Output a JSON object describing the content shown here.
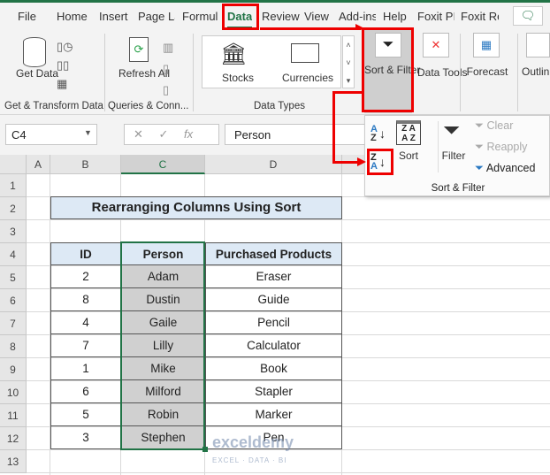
{
  "tabs": [
    "File",
    "Home",
    "Insert",
    "Page La",
    "Formul",
    "Data",
    "Review",
    "View",
    "Add-ins",
    "Help",
    "Foxit PI",
    "Foxit Re"
  ],
  "ribbon": {
    "get_data": "Get Data",
    "group_get": "Get & Transform Data",
    "refresh": "Refresh All",
    "group_queries": "Queries & Conn...",
    "stocks": "Stocks",
    "currencies": "Currencies",
    "group_types": "Data Types",
    "sort_filter": "Sort & Filter",
    "data_tools": "Data Tools",
    "forecast": "Forecast",
    "outline": "Outlin"
  },
  "sort_panel": {
    "sort": "Sort",
    "filter": "Filter",
    "clear": "Clear",
    "reapply": "Reapply",
    "advanced": "Advanced",
    "group": "Sort & Filter"
  },
  "formula_bar": {
    "name_box": "C4",
    "fx": "fx",
    "value": "Person"
  },
  "columns": [
    "A",
    "B",
    "C",
    "D"
  ],
  "rows": [
    "1",
    "2",
    "3",
    "4",
    "5",
    "6",
    "7",
    "8",
    "9",
    "10",
    "11",
    "12",
    "13"
  ],
  "sheet": {
    "title": "Rearranging Columns Using Sort",
    "headers": [
      "ID",
      "Person",
      "Purchased Products"
    ],
    "data": [
      [
        "2",
        "Adam",
        "Eraser"
      ],
      [
        "8",
        "Dustin",
        "Guide"
      ],
      [
        "4",
        "Gaile",
        "Pencil"
      ],
      [
        "7",
        "Lilly",
        "Calculator"
      ],
      [
        "1",
        "Mike",
        "Book"
      ],
      [
        "6",
        "Milford",
        "Stapler"
      ],
      [
        "5",
        "Robin",
        "Marker"
      ],
      [
        "3",
        "Stephen",
        "Pen"
      ]
    ]
  },
  "watermark": "exceldemy",
  "watermark_sub": "EXCEL · DATA · BI"
}
